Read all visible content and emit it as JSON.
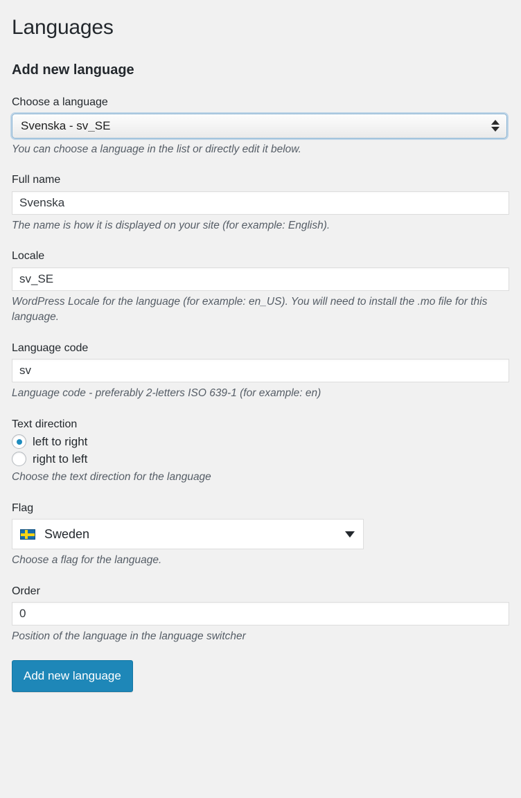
{
  "page": {
    "title": "Languages",
    "section_title": "Add new language"
  },
  "fields": {
    "choose_language": {
      "label": "Choose a language",
      "selected": "Svenska - sv_SE",
      "description": "You can choose a language in the list or directly edit it below."
    },
    "full_name": {
      "label": "Full name",
      "value": "Svenska",
      "placeholder": "",
      "description": "The name is how it is displayed on your site (for example: English)."
    },
    "locale": {
      "label": "Locale",
      "value": "sv_SE",
      "placeholder": "",
      "description": "WordPress Locale for the language (for example: en_US). You will need to install the .mo file for this language."
    },
    "language_code": {
      "label": "Language code",
      "value": "sv",
      "placeholder": "",
      "description": "Language code - preferably 2-letters ISO 639-1 (for example: en)"
    },
    "text_direction": {
      "label": "Text direction",
      "options": [
        {
          "label": "left to right",
          "checked": true
        },
        {
          "label": "right to left",
          "checked": false
        }
      ],
      "description": "Choose the text direction for the language"
    },
    "flag": {
      "label": "Flag",
      "selected": "Sweden",
      "icon": "sweden-flag-icon",
      "description": "Choose a flag for the language."
    },
    "order": {
      "label": "Order",
      "value": "0",
      "placeholder": "",
      "description": "Position of the language in the language switcher"
    }
  },
  "submit": {
    "label": "Add new language"
  },
  "colors": {
    "background": "#f1f1f1",
    "accent": "#1e87b8",
    "text": "#23282d",
    "description_text": "#555d66",
    "input_border": "#dddddd",
    "focus_border": "#8ab4d4",
    "flag_blue": "#1a6ead",
    "flag_yellow": "#f7d417"
  }
}
